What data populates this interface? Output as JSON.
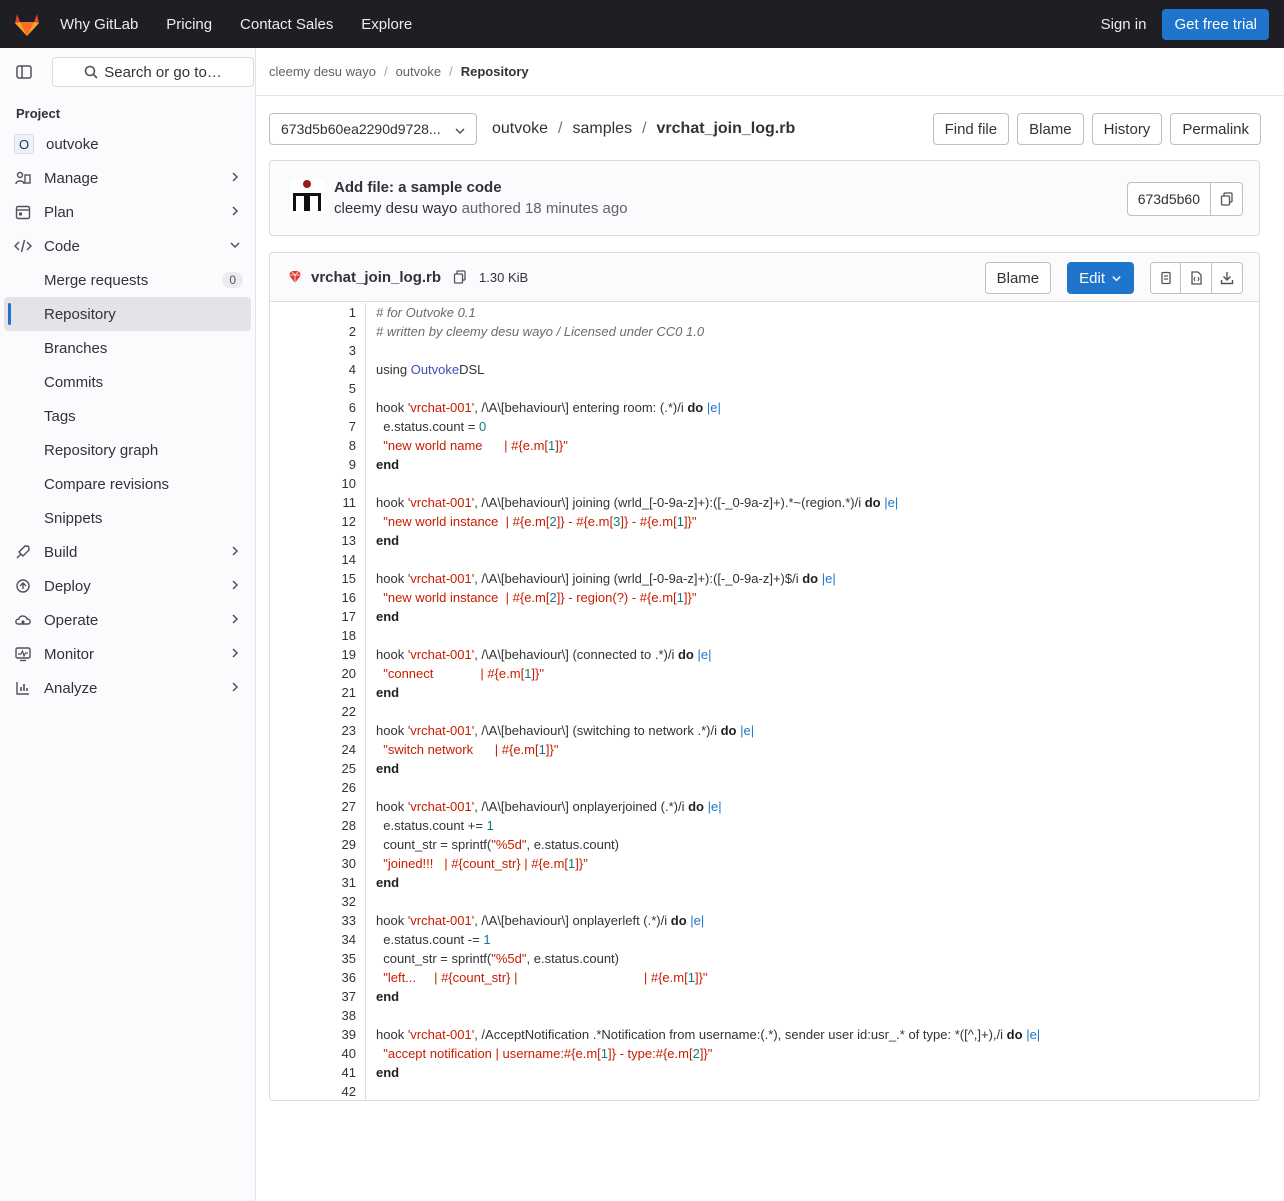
{
  "topbar": {
    "nav": [
      "Why GitLab",
      "Pricing",
      "Contact Sales",
      "Explore"
    ],
    "sign_in": "Sign in",
    "trial": "Get free trial"
  },
  "sidebar": {
    "search_label": "Search or go to…",
    "section": "Project",
    "project": {
      "initial": "O",
      "name": "outvoke"
    },
    "items": {
      "manage": "Manage",
      "plan": "Plan",
      "code": "Code",
      "build": "Build",
      "deploy": "Deploy",
      "operate": "Operate",
      "monitor": "Monitor",
      "analyze": "Analyze"
    },
    "code_sub": {
      "merge_requests": "Merge requests",
      "merge_requests_count": "0",
      "repository": "Repository",
      "branches": "Branches",
      "commits": "Commits",
      "tags": "Tags",
      "repository_graph": "Repository graph",
      "compare_revisions": "Compare revisions",
      "snippets": "Snippets"
    }
  },
  "breadcrumb": {
    "owner": "cleemy desu wayo",
    "project": "outvoke",
    "current": "Repository"
  },
  "pathbar": {
    "ref": "673d5b60ea2290d9728...",
    "path": [
      "outvoke",
      "samples"
    ],
    "file": "vrchat_join_log.rb",
    "buttons": {
      "find_file": "Find file",
      "blame": "Blame",
      "history": "History",
      "permalink": "Permalink"
    }
  },
  "commit": {
    "title": "Add file: a sample code",
    "author": "cleemy desu wayo",
    "authored": "authored",
    "time": "18 minutes ago",
    "sha": "673d5b60"
  },
  "file": {
    "name": "vrchat_join_log.rb",
    "size": "1.30 KiB",
    "blame": "Blame",
    "edit": "Edit",
    "line_numbers": [
      "1",
      "2",
      "3",
      "4",
      "5",
      "6",
      "7",
      "8",
      "9",
      "10",
      "11",
      "12",
      "13",
      "14",
      "15",
      "16",
      "17",
      "18",
      "19",
      "20",
      "21",
      "22",
      "23",
      "24",
      "25",
      "26",
      "27",
      "28",
      "29",
      "30",
      "31",
      "32",
      "33",
      "34",
      "35",
      "36",
      "37",
      "38",
      "39",
      "40",
      "41",
      "42"
    ],
    "lines": [
      [
        [
          "c",
          "# for Outvoke 0.1"
        ]
      ],
      [
        [
          "c",
          "# written by cleemy desu wayo / Licensed under CC0 1.0"
        ]
      ],
      [],
      [
        [
          "t",
          "using "
        ],
        [
          "n",
          "Outvoke"
        ],
        [
          "t",
          "DSL"
        ]
      ],
      [],
      [
        [
          "t",
          "hook "
        ],
        [
          "s",
          "'vrchat-001'"
        ],
        [
          "t",
          ", /\\A\\[behaviour\\] entering room: (.*)/i "
        ],
        [
          "k",
          "do"
        ],
        [
          "t",
          " "
        ],
        [
          "v",
          "|e|"
        ]
      ],
      [
        [
          "t",
          "  e.status.count = "
        ],
        [
          "m",
          "0"
        ]
      ],
      [
        [
          "t",
          "  "
        ],
        [
          "s",
          "\"new world name      | #{e.m["
        ],
        [
          "m",
          "1"
        ],
        [
          "s",
          "]}\""
        ]
      ],
      [
        [
          "k",
          "end"
        ]
      ],
      [],
      [
        [
          "t",
          "hook "
        ],
        [
          "s",
          "'vrchat-001'"
        ],
        [
          "t",
          ", /\\A\\[behaviour\\] joining (wrld_[-0-9a-z]+):([-_0-9a-z]+).*~(region.*)/i "
        ],
        [
          "k",
          "do"
        ],
        [
          "t",
          " "
        ],
        [
          "v",
          "|e|"
        ]
      ],
      [
        [
          "t",
          "  "
        ],
        [
          "s",
          "\"new world instance  | #{e.m["
        ],
        [
          "m",
          "2"
        ],
        [
          "s",
          "]} - #{e.m["
        ],
        [
          "m",
          "3"
        ],
        [
          "s",
          "]} - #{e.m["
        ],
        [
          "m",
          "1"
        ],
        [
          "s",
          "]}\""
        ]
      ],
      [
        [
          "k",
          "end"
        ]
      ],
      [],
      [
        [
          "t",
          "hook "
        ],
        [
          "s",
          "'vrchat-001'"
        ],
        [
          "t",
          ", /\\A\\[behaviour\\] joining (wrld_[-0-9a-z]+):([-_0-9a-z]+)$/i "
        ],
        [
          "k",
          "do"
        ],
        [
          "t",
          " "
        ],
        [
          "v",
          "|e|"
        ]
      ],
      [
        [
          "t",
          "  "
        ],
        [
          "s",
          "\"new world instance  | #{e.m["
        ],
        [
          "m",
          "2"
        ],
        [
          "s",
          "]} - region(?) - #{e.m["
        ],
        [
          "m",
          "1"
        ],
        [
          "s",
          "]}\""
        ]
      ],
      [
        [
          "k",
          "end"
        ]
      ],
      [],
      [
        [
          "t",
          "hook "
        ],
        [
          "s",
          "'vrchat-001'"
        ],
        [
          "t",
          ", /\\A\\[behaviour\\] (connected to .*)/i "
        ],
        [
          "k",
          "do"
        ],
        [
          "t",
          " "
        ],
        [
          "v",
          "|e|"
        ]
      ],
      [
        [
          "t",
          "  "
        ],
        [
          "s",
          "\"connect             | #{e.m["
        ],
        [
          "m",
          "1"
        ],
        [
          "s",
          "]}\""
        ]
      ],
      [
        [
          "k",
          "end"
        ]
      ],
      [],
      [
        [
          "t",
          "hook "
        ],
        [
          "s",
          "'vrchat-001'"
        ],
        [
          "t",
          ", /\\A\\[behaviour\\] (switching to network .*)/i "
        ],
        [
          "k",
          "do"
        ],
        [
          "t",
          " "
        ],
        [
          "v",
          "|e|"
        ]
      ],
      [
        [
          "t",
          "  "
        ],
        [
          "s",
          "\"switch network      | #{e.m["
        ],
        [
          "m",
          "1"
        ],
        [
          "s",
          "]}\""
        ]
      ],
      [
        [
          "k",
          "end"
        ]
      ],
      [],
      [
        [
          "t",
          "hook "
        ],
        [
          "s",
          "'vrchat-001'"
        ],
        [
          "t",
          ", /\\A\\[behaviour\\] onplayerjoined (.*)/i "
        ],
        [
          "k",
          "do"
        ],
        [
          "t",
          " "
        ],
        [
          "v",
          "|e|"
        ]
      ],
      [
        [
          "t",
          "  e.status.count += "
        ],
        [
          "m",
          "1"
        ]
      ],
      [
        [
          "t",
          "  count_str = sprintf("
        ],
        [
          "s",
          "\"%5d\""
        ],
        [
          "t",
          ", e.status.count)"
        ]
      ],
      [
        [
          "t",
          "  "
        ],
        [
          "s",
          "\"joined!!!   | #{count_str} | #{e.m["
        ],
        [
          "m",
          "1"
        ],
        [
          "s",
          "]}\""
        ]
      ],
      [
        [
          "k",
          "end"
        ]
      ],
      [],
      [
        [
          "t",
          "hook "
        ],
        [
          "s",
          "'vrchat-001'"
        ],
        [
          "t",
          ", /\\A\\[behaviour\\] onplayerleft (.*)/i "
        ],
        [
          "k",
          "do"
        ],
        [
          "t",
          " "
        ],
        [
          "v",
          "|e|"
        ]
      ],
      [
        [
          "t",
          "  e.status.count -= "
        ],
        [
          "m",
          "1"
        ]
      ],
      [
        [
          "t",
          "  count_str = sprintf("
        ],
        [
          "s",
          "\"%5d\""
        ],
        [
          "t",
          ", e.status.count)"
        ]
      ],
      [
        [
          "t",
          "  "
        ],
        [
          "s",
          "\"left...     | #{count_str} |                                   | #{e.m["
        ],
        [
          "m",
          "1"
        ],
        [
          "s",
          "]}\""
        ]
      ],
      [
        [
          "k",
          "end"
        ]
      ],
      [],
      [
        [
          "t",
          "hook "
        ],
        [
          "s",
          "'vrchat-001'"
        ],
        [
          "t",
          ", /AcceptNotification .*Notification from username:(.*), sender user id:usr_.* of type: *([^,]+),/i "
        ],
        [
          "k",
          "do"
        ],
        [
          "t",
          " "
        ],
        [
          "v",
          "|e|"
        ]
      ],
      [
        [
          "t",
          "  "
        ],
        [
          "s",
          "\"accept notification | username:#{e.m["
        ],
        [
          "m",
          "1"
        ],
        [
          "s",
          "]} - type:#{e.m["
        ],
        [
          "m",
          "2"
        ],
        [
          "s",
          "]}\""
        ]
      ],
      [
        [
          "k",
          "end"
        ]
      ],
      []
    ]
  },
  "icons": [
    "gitlab-logo-icon",
    "sidebar-toggle-icon",
    "search-icon",
    "chevron-right-icon",
    "chevron-down-icon",
    "copy-icon",
    "ruby-file-icon",
    "code-icon",
    "download-icon"
  ],
  "colors": {
    "topbar": "#1f1e24",
    "accent": "#1f75cb",
    "string": "#c91c00",
    "number": "#0b7a83"
  }
}
